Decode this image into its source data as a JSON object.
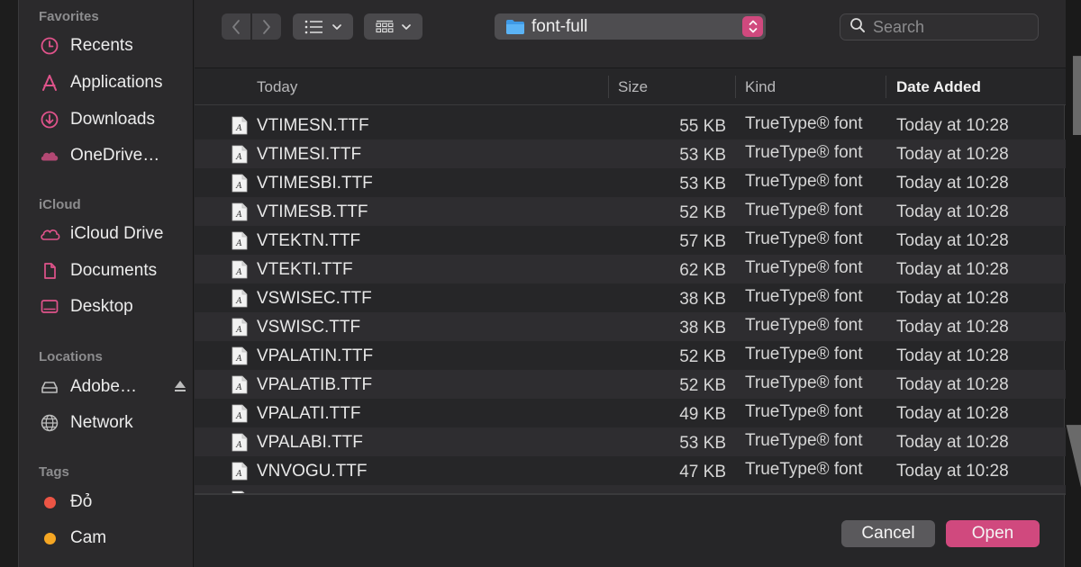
{
  "sidebar": {
    "sections": [
      {
        "heading": "Favorites",
        "items": [
          {
            "label": "Recents",
            "icon": "clock-icon"
          },
          {
            "label": "Applications",
            "icon": "applications-icon"
          },
          {
            "label": "Downloads",
            "icon": "download-icon"
          },
          {
            "label": "OneDrive…",
            "icon": "cloud-filled-icon"
          }
        ]
      },
      {
        "heading": "iCloud",
        "items": [
          {
            "label": "iCloud Drive",
            "icon": "cloud-icon"
          },
          {
            "label": "Documents",
            "icon": "document-icon"
          },
          {
            "label": "Desktop",
            "icon": "desktop-icon"
          }
        ]
      },
      {
        "heading": "Locations",
        "items": [
          {
            "label": "Adobe…",
            "icon": "drive-icon"
          },
          {
            "label": "Network",
            "icon": "globe-icon"
          }
        ]
      },
      {
        "heading": "Tags",
        "items": [
          {
            "label": "Đỏ",
            "color": "#ec5545"
          },
          {
            "label": "Cam",
            "color": "#f5a623"
          }
        ]
      }
    ]
  },
  "toolbar": {
    "path": "font-full",
    "search_placeholder": "Search"
  },
  "columns": {
    "name": "Today",
    "size": "Size",
    "kind": "Kind",
    "date": "Date Added"
  },
  "files": [
    {
      "name": "VTIMESN.TTF",
      "size": "55 KB",
      "kind": "TrueType® font",
      "date": "Today at 10:28"
    },
    {
      "name": "VTIMESI.TTF",
      "size": "53 KB",
      "kind": "TrueType® font",
      "date": "Today at 10:28"
    },
    {
      "name": "VTIMESBI.TTF",
      "size": "53 KB",
      "kind": "TrueType® font",
      "date": "Today at 10:28"
    },
    {
      "name": "VTIMESB.TTF",
      "size": "52 KB",
      "kind": "TrueType® font",
      "date": "Today at 10:28"
    },
    {
      "name": "VTEKTN.TTF",
      "size": "57 KB",
      "kind": "TrueType® font",
      "date": "Today at 10:28"
    },
    {
      "name": "VTEKTI.TTF",
      "size": "62 KB",
      "kind": "TrueType® font",
      "date": "Today at 10:28"
    },
    {
      "name": "VSWISEC.TTF",
      "size": "38 KB",
      "kind": "TrueType® font",
      "date": "Today at 10:28"
    },
    {
      "name": "VSWISC.TTF",
      "size": "38 KB",
      "kind": "TrueType® font",
      "date": "Today at 10:28"
    },
    {
      "name": "VPALATIN.TTF",
      "size": "52 KB",
      "kind": "TrueType® font",
      "date": "Today at 10:28"
    },
    {
      "name": "VPALATIB.TTF",
      "size": "52 KB",
      "kind": "TrueType® font",
      "date": "Today at 10:28"
    },
    {
      "name": "VPALATI.TTF",
      "size": "49 KB",
      "kind": "TrueType® font",
      "date": "Today at 10:28"
    },
    {
      "name": "VPALABI.TTF",
      "size": "53 KB",
      "kind": "TrueType® font",
      "date": "Today at 10:28"
    },
    {
      "name": "VNVOGU.TTF",
      "size": "47 KB",
      "kind": "TrueType® font",
      "date": "Today at 10:28"
    }
  ],
  "footer": {
    "cancel_label": "Cancel",
    "open_label": "Open"
  },
  "colors": {
    "accent": "#d0497e",
    "sidebar_icon": "#e0538b"
  }
}
